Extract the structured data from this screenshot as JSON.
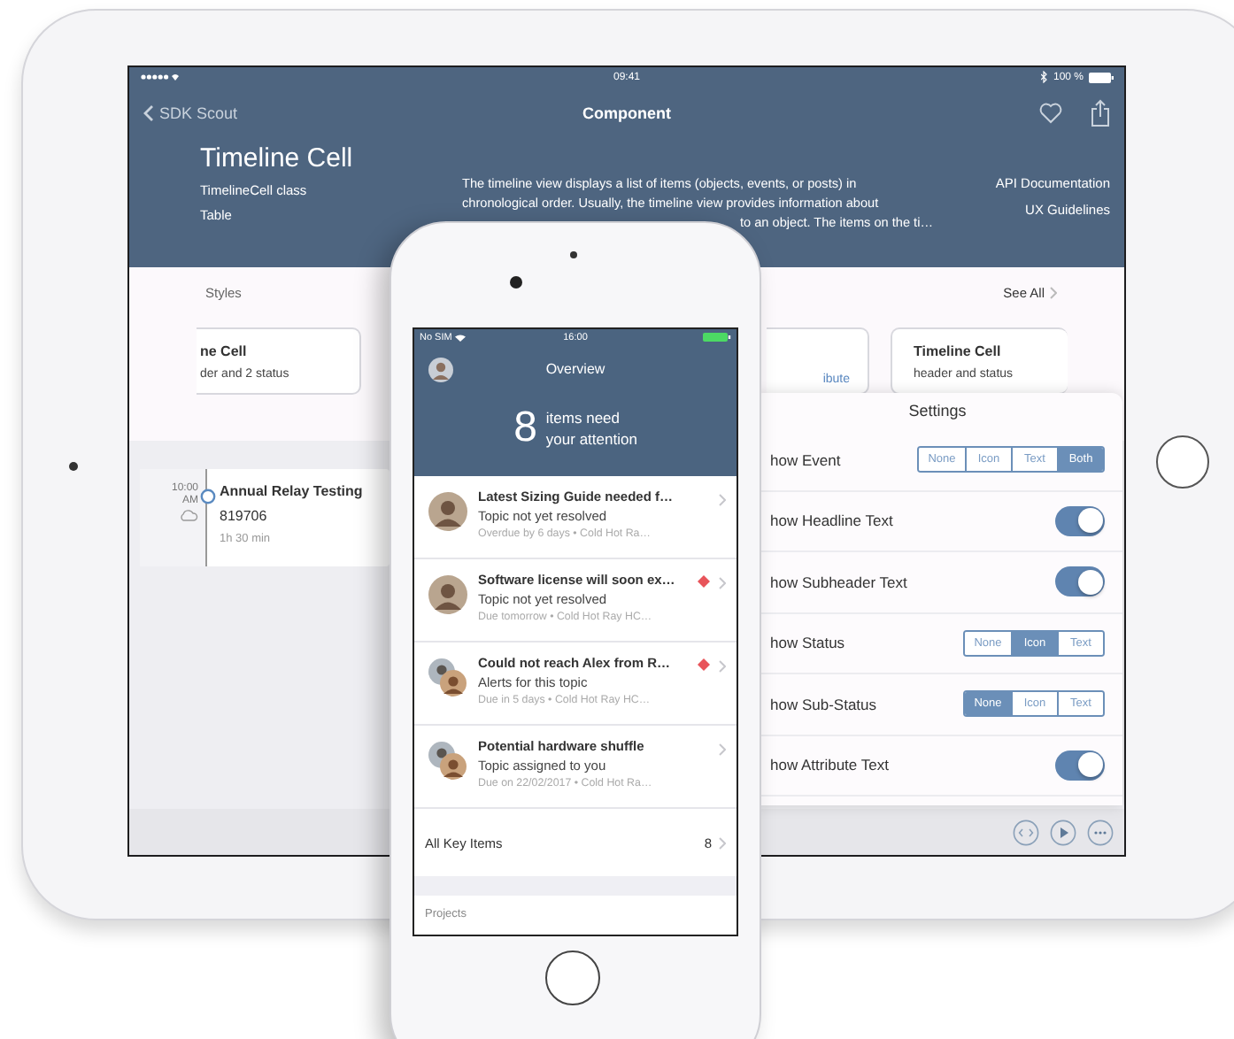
{
  "tablet": {
    "status_bar": {
      "time": "09:41",
      "battery": "100 %"
    },
    "nav": {
      "back": "SDK Scout",
      "title": "Component"
    },
    "header": {
      "title": "Timeline Cell",
      "subtitle": "TimelineCell class",
      "category": "Table",
      "description": [
        "The timeline view displays a list of items (objects, events, or posts) in",
        "chronological order. Usually, the timeline view provides information about",
        "to an object. The items on the ti…"
      ],
      "links": [
        "API Documentation",
        "UX Guidelines"
      ]
    },
    "styles": {
      "title": "Styles",
      "see_all": "See All",
      "cards": [
        {
          "kind": "text",
          "title": "ne Cell",
          "subtitle": "der and 2 status"
        },
        {
          "kind": "link",
          "link": "ibute"
        },
        {
          "kind": "text",
          "title": "Timeline Cell",
          "subtitle": "header and status"
        }
      ]
    },
    "timeline": {
      "time": "10:00",
      "period": "AM",
      "title": "Annual Relay Testing",
      "number": "819706",
      "duration": "1h 30 min"
    },
    "settings": {
      "title": "Settings",
      "rows": [
        {
          "kind": "segments",
          "label": "how Event",
          "options": [
            {
              "label": "None",
              "selected": false
            },
            {
              "label": "Icon",
              "selected": false
            },
            {
              "label": "Text",
              "selected": false
            },
            {
              "label": "Both",
              "selected": true
            }
          ]
        },
        {
          "kind": "toggle",
          "label": "how Headline Text",
          "on": true
        },
        {
          "kind": "toggle",
          "label": "how Subheader Text",
          "on": true
        },
        {
          "kind": "segments",
          "label": "how Status",
          "options": [
            {
              "label": "None",
              "selected": false
            },
            {
              "label": "Icon",
              "selected": true
            },
            {
              "label": "Text",
              "selected": false
            }
          ]
        },
        {
          "kind": "segments",
          "label": "how Sub-Status",
          "options": [
            {
              "label": "None",
              "selected": true
            },
            {
              "label": "Icon",
              "selected": false
            },
            {
              "label": "Text",
              "selected": false
            }
          ]
        },
        {
          "kind": "toggle",
          "label": "how Attribute Text",
          "on": true
        }
      ]
    }
  },
  "phone": {
    "status_bar": {
      "carrier": "No SIM",
      "time": "16:00"
    },
    "header": {
      "title": "Overview",
      "count": "8",
      "message": [
        "items need",
        "your attention"
      ]
    },
    "items": [
      {
        "group": false,
        "title": "Latest Sizing Guide needed f…",
        "subtitle": "Topic not yet resolved",
        "meta": "Overdue by 6 days • Cold Hot Ra…",
        "flagged": false
      },
      {
        "group": false,
        "title": "Software license will soon ex…",
        "subtitle": "Topic not yet resolved",
        "meta": "Due tomorrow • Cold Hot Ray HC…",
        "flagged": true
      },
      {
        "group": true,
        "title": "Could not reach Alex from R…",
        "subtitle": "Alerts for this topic",
        "meta": "Due in 5 days • Cold Hot Ray HC…",
        "flagged": true
      },
      {
        "group": true,
        "title": "Potential hardware shuffle",
        "subtitle": "Topic assigned to you",
        "meta": "Due on 22/02/2017 • Cold Hot Ra…",
        "flagged": false
      }
    ],
    "all_items": {
      "label": "All Key Items",
      "count": "8"
    },
    "section": "Projects"
  }
}
